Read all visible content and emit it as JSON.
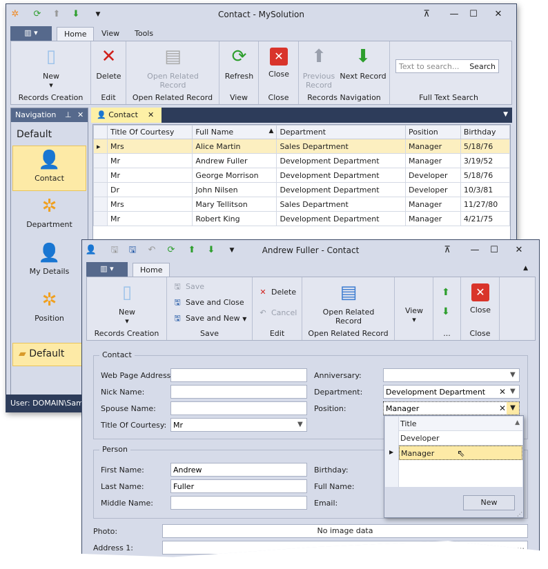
{
  "main": {
    "title": "Contact - MySolution",
    "tabs": [
      "Home",
      "View",
      "Tools"
    ],
    "groups": {
      "records_creation": "Records Creation",
      "edit": "Edit",
      "open_related": "Open Related Record",
      "view": "View",
      "close": "Close",
      "navigation": "Records Navigation",
      "search": "Full Text Search"
    },
    "buttons": {
      "new": "New",
      "delete": "Delete",
      "open_related": "Open Related Record",
      "refresh": "Refresh",
      "close": "Close",
      "previous": "Previous Record",
      "next": "Next Record"
    },
    "search": {
      "placeholder": "Text to search...",
      "button": "Search"
    },
    "nav": {
      "title": "Navigation",
      "group": "Default",
      "items": [
        "Contact",
        "Department",
        "My Details",
        "Position"
      ],
      "bottom_group": "Default"
    },
    "doc_tab": "Contact",
    "status": "User: DOMAIN\\Samp",
    "grid": {
      "columns": [
        "Title Of Courtesy",
        "Full Name",
        "Department",
        "Position",
        "Birthday"
      ],
      "rows": [
        [
          "Mrs",
          "Alice Martin",
          "Sales Department",
          "Manager",
          "5/18/76"
        ],
        [
          "Mr",
          "Andrew Fuller",
          "Development Department",
          "Manager",
          "3/19/52"
        ],
        [
          "Mr",
          "George Morrison",
          "Development Department",
          "Developer",
          "5/18/76"
        ],
        [
          "Dr",
          "John Nilsen",
          "Development Department",
          "Developer",
          "10/3/81"
        ],
        [
          "Mrs",
          "Mary Tellitson",
          "Sales Department",
          "Manager",
          "11/27/80"
        ],
        [
          "Mr",
          "Robert King",
          "Development Department",
          "Manager",
          "4/21/75"
        ]
      ]
    }
  },
  "dialog": {
    "title": "Andrew Fuller - Contact",
    "tab": "Home",
    "groups": {
      "records_creation": "Records Creation",
      "save": "Save",
      "edit": "Edit",
      "open_related": "Open Related Record",
      "nav": "...",
      "close": "Close"
    },
    "buttons": {
      "new": "New",
      "save": "Save",
      "save_close": "Save and Close",
      "save_new": "Save and New",
      "delete": "Delete",
      "cancel": "Cancel",
      "open_related": "Open Related Record",
      "view": "View",
      "close": "Close"
    },
    "contact": {
      "legend": "Contact",
      "web_label": "Web Page Address:",
      "web": "",
      "nick_label": "Nick Name:",
      "nick": "",
      "spouse_label": "Spouse Name:",
      "spouse": "",
      "courtesy_label": "Title Of Courtesy:",
      "courtesy": "Mr",
      "anniv_label": "Anniversary:",
      "anniv": "",
      "dept_label": "Department:",
      "dept": "Development Department",
      "pos_label": "Position:",
      "pos": "Manager"
    },
    "person": {
      "legend": "Person",
      "first_label": "First Name:",
      "first": "Andrew",
      "last_label": "Last Name:",
      "last": "Fuller",
      "middle_label": "Middle Name:",
      "middle": "",
      "birthday_label": "Birthday:",
      "fullname_label": "Full Name:",
      "email_label": "Email:"
    },
    "photo_label": "Photo:",
    "photo": "No image data",
    "address_label": "Address 1:",
    "popup": {
      "column": "Title",
      "items": [
        "Developer",
        "Manager"
      ],
      "selected": "Manager",
      "new_button": "New"
    }
  }
}
